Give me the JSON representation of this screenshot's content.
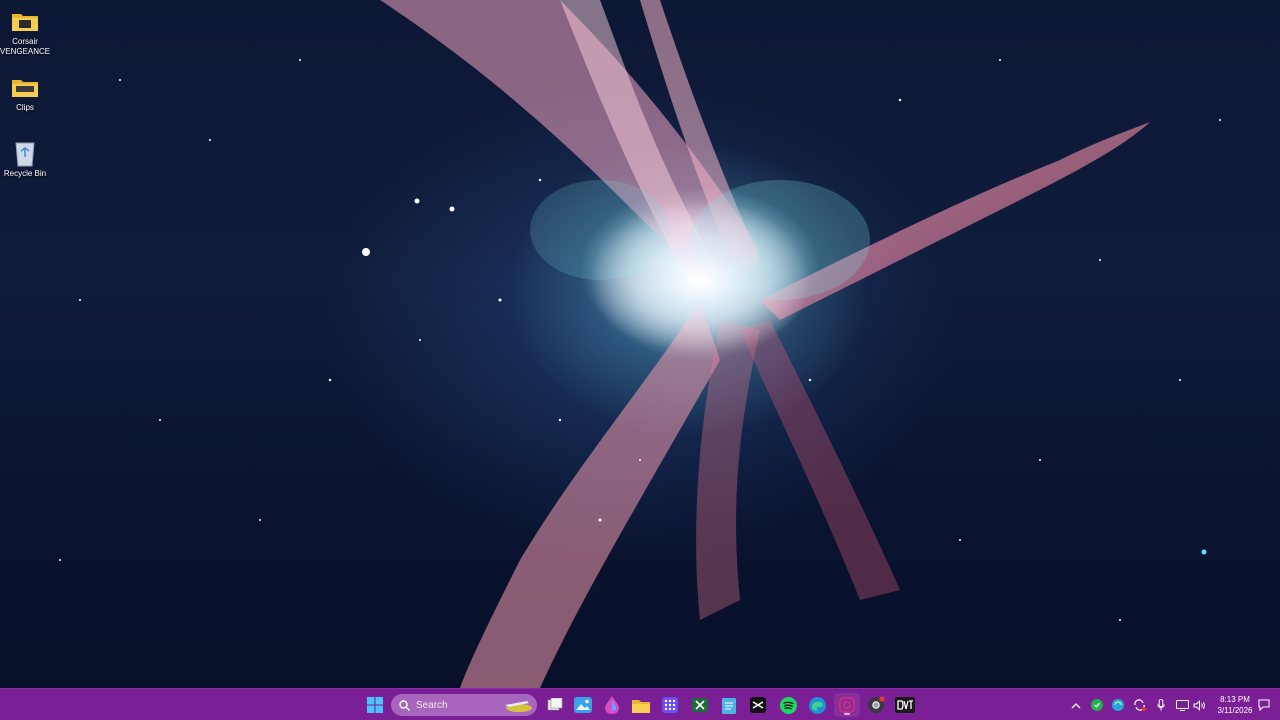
{
  "desktop": {
    "icons": [
      {
        "label": "Corsair VENGEANCE",
        "icon": "folder-icon"
      },
      {
        "label": "Clips",
        "icon": "folder-icon"
      },
      {
        "label": "Recycle Bin",
        "icon": "recycle-bin-icon"
      }
    ]
  },
  "taskbar": {
    "color": "#7a1f96",
    "search": {
      "placeholder": "Search"
    },
    "pinned_apps": [
      "start-icon",
      "task-view-icon",
      "photos-icon",
      "copilot-icon",
      "file-explorer-icon",
      "app-grid-icon",
      "excel-icon",
      "notepad-icon",
      "capcut-icon",
      "spotify-icon",
      "edge-icon",
      "instagram-icon",
      "chrome-icon",
      "dvt-app-icon"
    ]
  },
  "system_tray": {
    "icons": [
      "chevron-up-icon",
      "security-icon",
      "cloud-sync-icon",
      "update-icon",
      "microphone-icon",
      "network-icon",
      "volume-icon"
    ],
    "clock": {
      "time": "8:13 PM",
      "date": "3/11/2026"
    }
  }
}
